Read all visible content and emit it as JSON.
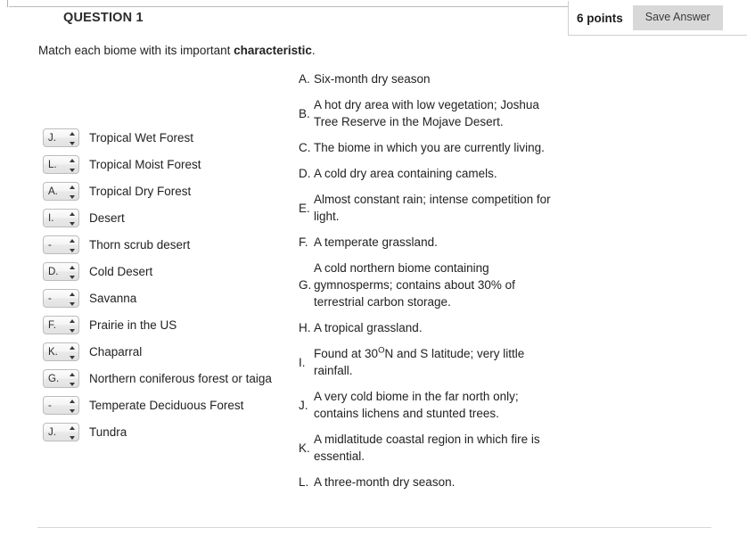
{
  "header": {
    "question_title": "QUESTION 1",
    "points_label": "6 points",
    "save_button_label": "Save Answer"
  },
  "prompt": {
    "text_before": "Match each biome with its important ",
    "text_bold": "characteristic",
    "text_after": "."
  },
  "matching_rows": [
    {
      "selected": "J.",
      "biome": "Tropical Wet Forest"
    },
    {
      "selected": "L.",
      "biome": "Tropical Moist Forest"
    },
    {
      "selected": "A.",
      "biome": "Tropical Dry Forest"
    },
    {
      "selected": "I.",
      "biome": "Desert"
    },
    {
      "selected": "-",
      "biome": "Thorn scrub desert"
    },
    {
      "selected": "D.",
      "biome": "Cold Desert"
    },
    {
      "selected": "-",
      "biome": "Savanna"
    },
    {
      "selected": "F.",
      "biome": "Prairie in the US"
    },
    {
      "selected": "K.",
      "biome": "Chaparral"
    },
    {
      "selected": "G.",
      "biome": "Northern coniferous forest or taiga"
    },
    {
      "selected": "-",
      "biome": "Temperate Deciduous Forest"
    },
    {
      "selected": "J.",
      "biome": "Tundra"
    }
  ],
  "options": [
    {
      "letter": "A.",
      "text": "Six-month dry season"
    },
    {
      "letter": "B.",
      "text": "A hot dry area with low vegetation; Joshua Tree Reserve in the Mojave Desert."
    },
    {
      "letter": "C.",
      "text": "The biome in which you are currently living."
    },
    {
      "letter": "D.",
      "text": "A cold dry area containing camels."
    },
    {
      "letter": "E.",
      "text": "Almost constant rain; intense competition for light."
    },
    {
      "letter": "F.",
      "text": "A temperate grassland."
    },
    {
      "letter": "G.",
      "text": "A cold northern biome containing gymnosperms; contains about 30% of terrestrial carbon storage."
    },
    {
      "letter": "H.",
      "text": "A tropical grassland."
    },
    {
      "letter": "I.",
      "text": "Found at 30°N and S latitude; very little rainfall."
    },
    {
      "letter": "J.",
      "text": "A very cold biome in the far north only; contains lichens and stunted trees."
    },
    {
      "letter": "K.",
      "text": "A midlatitude coastal region in which fire is essential."
    },
    {
      "letter": "L.",
      "text": "A three-month dry season."
    }
  ],
  "option_i_parts": {
    "before": "Found at 30",
    "sup": "O",
    "after": "N and S latitude; very little rainfall."
  },
  "colors": {
    "text": "#222222",
    "panel_border": "#cfcfcf",
    "button_bg": "#d8d8d8",
    "rule": "#d6d6d6"
  }
}
